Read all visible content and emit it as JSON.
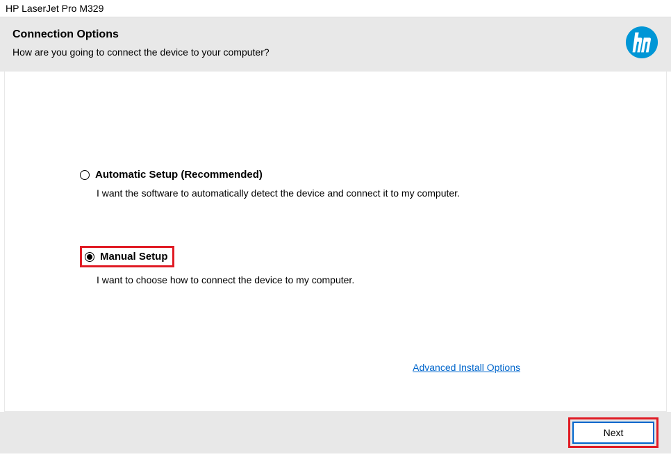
{
  "window": {
    "title": "HP LaserJet Pro M329"
  },
  "header": {
    "title": "Connection Options",
    "subtitle": "How are you going to connect the device to your computer?"
  },
  "options": {
    "automatic": {
      "label": "Automatic Setup (Recommended)",
      "description": "I want the software to automatically detect the device and connect it to my computer.",
      "selected": false
    },
    "manual": {
      "label": "Manual Setup",
      "description": "I want to choose how to connect the device to my computer.",
      "selected": true
    }
  },
  "links": {
    "advanced": "Advanced Install Options"
  },
  "buttons": {
    "next": "Next"
  },
  "colors": {
    "hp_blue": "#0096d6",
    "highlight_red": "#e01b24",
    "link_blue": "#0066cc",
    "header_gray": "#e8e8e8"
  }
}
